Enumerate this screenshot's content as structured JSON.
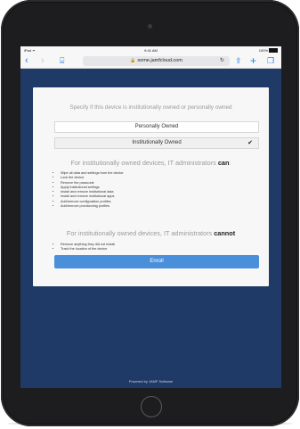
{
  "status_bar": {
    "carrier": "iPad ᯤ",
    "time": "9:41 AM",
    "battery": "100%"
  },
  "toolbar": {
    "url": "some.jamfcloud.com",
    "back_icon": "chevron-left-icon",
    "forward_icon": "chevron-right-icon",
    "bookmarks_icon": "book-icon",
    "reload_icon": "reload-icon",
    "share_icon": "share-icon",
    "new_tab_icon": "plus-icon",
    "tabs_icon": "tabs-icon"
  },
  "enrollment": {
    "prompt": "Specify if this device is institutionally owned or personally owned",
    "options": [
      {
        "label": "Personally Owned",
        "selected": false
      },
      {
        "label": "Institutionally Owned",
        "selected": true
      }
    ],
    "can_heading_prefix": "For institutionally owned devices, IT administrators",
    "can_heading_bold": "can",
    "can_items": [
      "Wipe all data and settings from the device",
      "Lock the device",
      "Remove the passcode",
      "Apply institutional settings",
      "Install and remove institutional data",
      "Install and remove institutional apps",
      "Add/remove configuration profiles",
      "Add/remove provisioning profiles"
    ],
    "cannot_heading_prefix": "For institutionally owned devices, IT administrators",
    "cannot_heading_bold": "cannot",
    "cannot_items": [
      "Remove anything they did not install",
      "Track the location of the device"
    ],
    "enroll_label": "Enroll"
  },
  "footer": "Powered by JAMF Software",
  "colors": {
    "page_background": "#1f3a66",
    "enroll_button": "#4a8fda",
    "safari_blue": "#1a7ff0"
  }
}
